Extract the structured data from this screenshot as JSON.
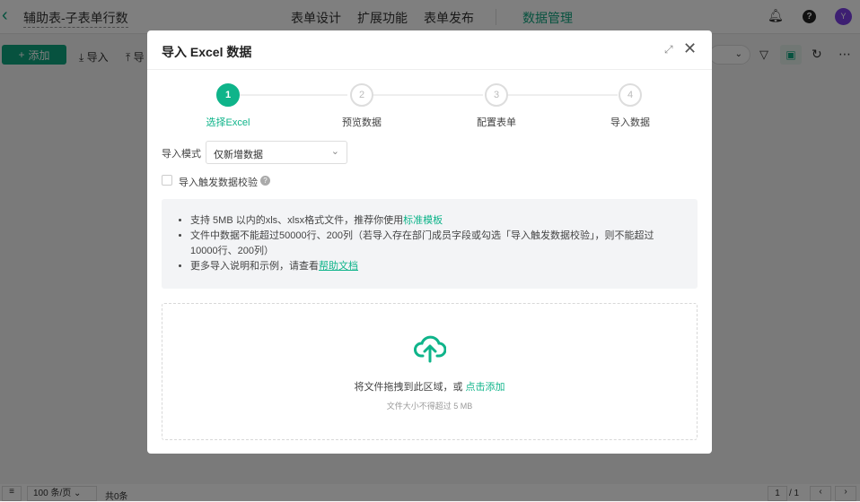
{
  "header": {
    "title": "辅助表-子表单行数",
    "nav": [
      "表单设计",
      "扩展功能",
      "表单发布",
      "数据管理"
    ],
    "avatar": "Y"
  },
  "toolbar": {
    "add": "添加",
    "import": "导入",
    "export": "导"
  },
  "footer": {
    "page_size": "100 条/页",
    "total": "共0条",
    "page": "1",
    "pages": "/ 1"
  },
  "modal": {
    "title": "导入 Excel 数据",
    "steps": [
      {
        "num": "1",
        "label": "选择Excel"
      },
      {
        "num": "2",
        "label": "预览数据"
      },
      {
        "num": "3",
        "label": "配置表单"
      },
      {
        "num": "4",
        "label": "导入数据"
      }
    ],
    "mode_label": "导入模式",
    "mode_value": "仅新增数据",
    "checkbox_label": "导入触发数据校验",
    "info": {
      "line1": "支持 5MB 以内的xls、xlsx格式文件，推荐你使用",
      "line1_link": "标准模板",
      "line2": "文件中数据不能超过50000行、200列（若导入存在部门成员字段或勾选「导入触发数据校验」，则不能超过10000行、200列）",
      "line3": "更多导入说明和示例，请查看",
      "line3_link": "帮助文档"
    },
    "drop": {
      "text": "将文件拖拽到此区域，或 ",
      "link": "点击添加",
      "hint": "文件大小不得超过 5 MB"
    }
  },
  "colors": {
    "accent": "#0fb48a"
  }
}
